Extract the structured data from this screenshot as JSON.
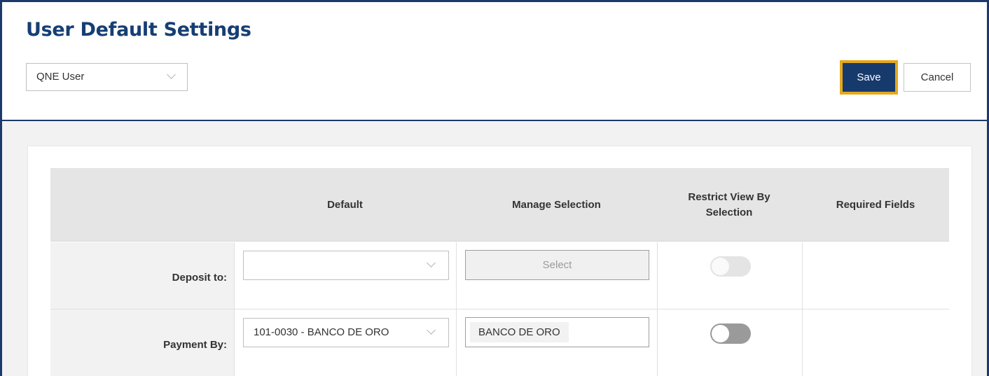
{
  "header": {
    "title": "User Default Settings",
    "user_select": {
      "value": "QNE User"
    },
    "save_label": "Save",
    "cancel_label": "Cancel"
  },
  "table": {
    "columns": [
      "",
      "Default",
      "Manage Selection",
      "Restrict View By Selection",
      "Required Fields"
    ],
    "rows": [
      {
        "label": "Deposit to:",
        "default_value": "",
        "manage_selection": {
          "type": "button",
          "label": "Select",
          "disabled": true
        },
        "restrict_view": {
          "on": false,
          "disabled": true
        },
        "required_fields": ""
      },
      {
        "label": "Payment By:",
        "default_value": "101-0030 - BANCO DE ORO",
        "manage_selection": {
          "type": "tags",
          "tags": [
            "BANCO DE ORO"
          ]
        },
        "restrict_view": {
          "on": false,
          "disabled": false
        },
        "required_fields": ""
      }
    ]
  },
  "colors": {
    "brand_navy": "#173a6c",
    "focus_outline": "#e5a81c",
    "header_bg": "#e5e5e5",
    "page_bg": "#f2f2f2"
  },
  "icons": [
    "chevron-down-icon"
  ]
}
